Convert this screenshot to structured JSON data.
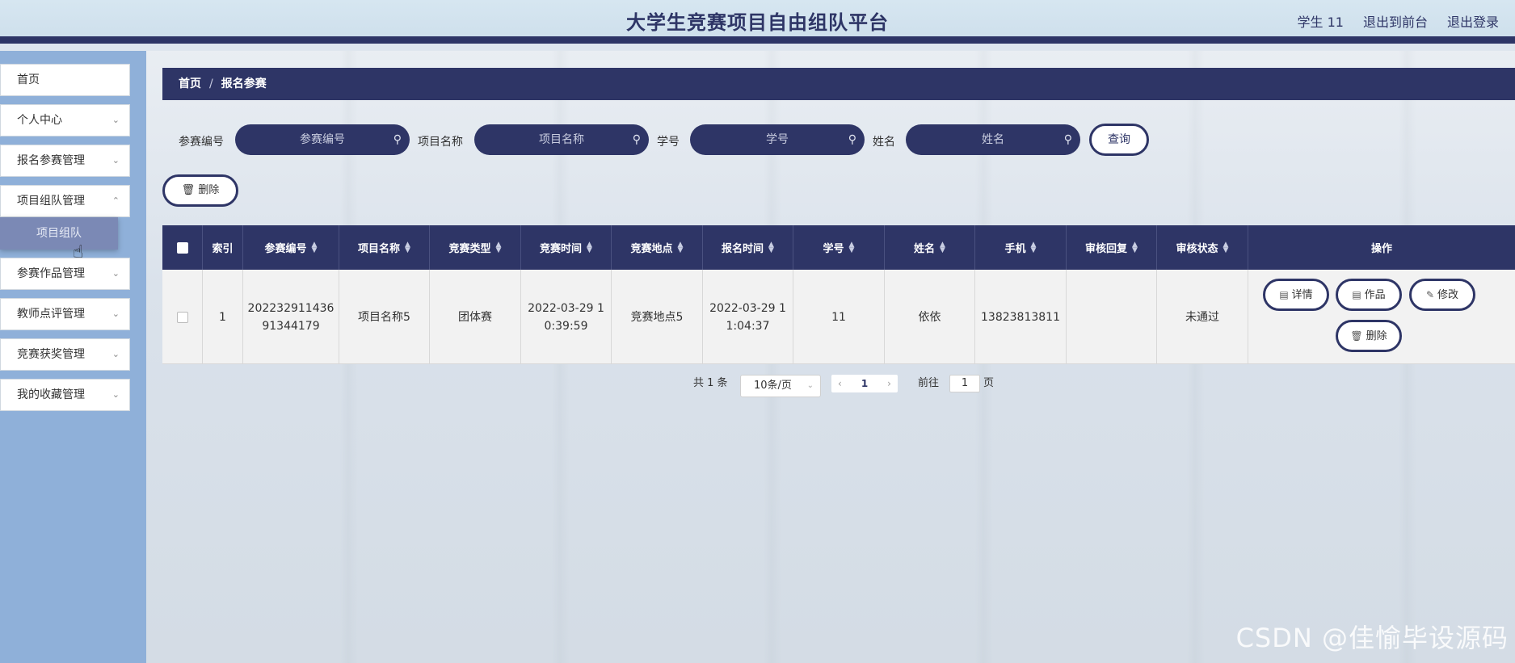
{
  "header": {
    "title": "大学生竞赛项目自由组队平台",
    "user": "学生 11",
    "back_front": "退出到前台",
    "logout": "退出登录"
  },
  "sidebar": {
    "items": [
      {
        "label": "首页"
      },
      {
        "label": "个人中心"
      },
      {
        "label": "报名参赛管理"
      },
      {
        "label": "项目组队管理"
      },
      {
        "label": "参赛作品管理"
      },
      {
        "label": "教师点评管理"
      },
      {
        "label": "竞赛获奖管理"
      },
      {
        "label": "我的收藏管理"
      }
    ],
    "submenu_item": "项目组队"
  },
  "breadcrumb": {
    "home": "首页",
    "separator": "/",
    "current": "报名参赛"
  },
  "search": {
    "fields": [
      {
        "label": "参赛编号",
        "placeholder": "参赛编号"
      },
      {
        "label": "项目名称",
        "placeholder": "项目名称"
      },
      {
        "label": "学号",
        "placeholder": "学号"
      },
      {
        "label": "姓名",
        "placeholder": "姓名"
      }
    ],
    "query_label": "查询",
    "delete_label": "删除"
  },
  "table": {
    "headers": {
      "index": "索引",
      "code": "参赛编号",
      "project": "项目名称",
      "type": "竞赛类型",
      "time": "竞赛时间",
      "place": "竞赛地点",
      "signup": "报名时间",
      "student_no": "学号",
      "name": "姓名",
      "phone": "手机",
      "reply": "审核回复",
      "status": "审核状态",
      "ops": "操作"
    },
    "rows": [
      {
        "index": "1",
        "code": "20223291143691344179",
        "project": "项目名称5",
        "type": "团体赛",
        "time": "2022-03-29 10:39:59",
        "place": "竞赛地点5",
        "signup": "2022-03-29 11:04:37",
        "student_no": "11",
        "name": "依依",
        "phone": "13823813811",
        "reply": "",
        "status": "未通过"
      }
    ],
    "row_actions": {
      "detail": "详情",
      "works": "作品",
      "edit": "修改",
      "delete": "删除"
    }
  },
  "pagination": {
    "total": "共 1 条",
    "page_size": "10条/页",
    "current_page": "1",
    "goto_prefix": "前往",
    "goto_value": "1",
    "goto_suffix": "页"
  },
  "watermark": "CSDN @佳愉毕设源码",
  "colors": {
    "primary": "#2e3566",
    "sidebar": "#8fb0d9",
    "header_bg": "#d6e6f1"
  }
}
